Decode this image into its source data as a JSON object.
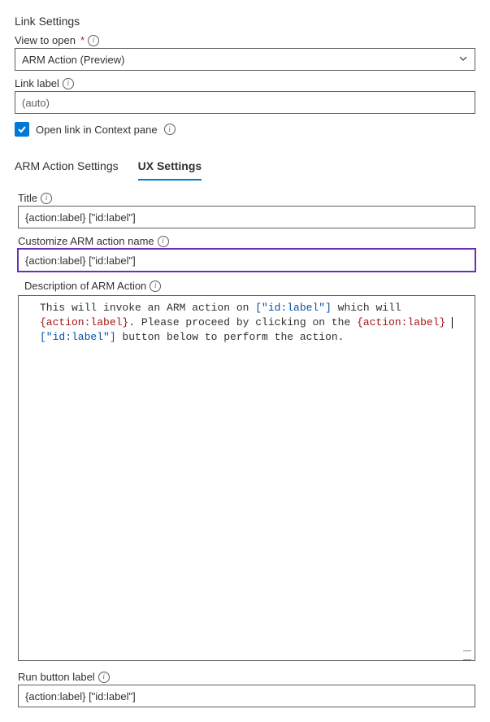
{
  "header": "Link Settings",
  "view_to_open": {
    "label": "View to open",
    "value": "ARM Action (Preview)"
  },
  "link_label": {
    "label": "Link label",
    "placeholder": "(auto)"
  },
  "open_in_context": {
    "label": "Open link in Context pane",
    "checked": true
  },
  "tabs": {
    "arm": "ARM Action Settings",
    "ux": "UX Settings"
  },
  "ux": {
    "title_label": "Title",
    "title_value": "{action:label} [\"id:label\"]",
    "customize_label": "Customize ARM action name",
    "customize_value": "{action:label} [\"id:label\"]",
    "description_label": "Description of ARM Action",
    "desc_parts": {
      "p1": "This will invoke an ARM action on ",
      "id1": "[\"id:label\"]",
      "p2": " which will ",
      "act1": "{action:label}",
      "p3": ". Please proceed by clicking on the ",
      "act2": "{action:label}",
      "id2": "[\"id:label\"]",
      "p4": " button below to perform the action."
    },
    "run_button_label": "Run button label",
    "run_button_value": "{action:label} [\"id:label\"]"
  }
}
